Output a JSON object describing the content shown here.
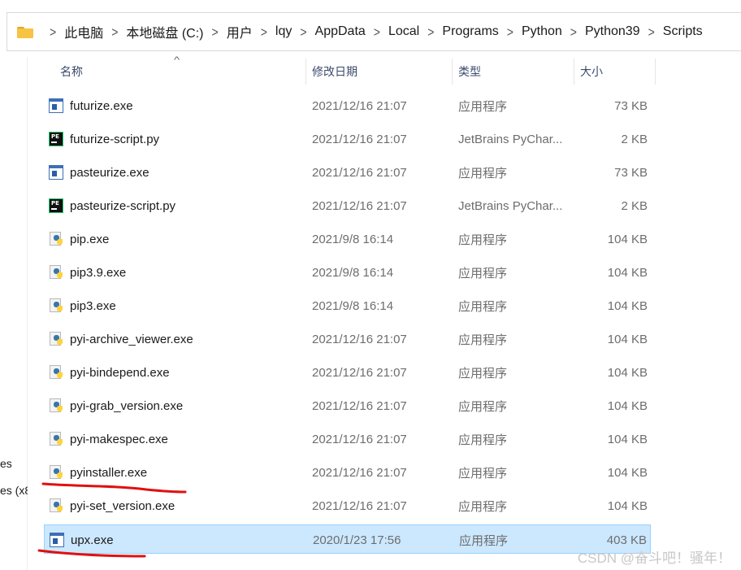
{
  "breadcrumb": [
    "此电脑",
    "本地磁盘 (C:)",
    "用户",
    "lqy",
    "AppData",
    "Local",
    "Programs",
    "Python",
    "Python39",
    "Scripts"
  ],
  "nav_fragments": [
    "es",
    "es (x8"
  ],
  "columns": {
    "name": "名称",
    "date": "修改日期",
    "type": "类型",
    "size": "大小"
  },
  "files": [
    {
      "name": "futurize.exe",
      "date": "2021/12/16 21:07",
      "type": "应用程序",
      "size": "73 KB",
      "icon": "exe-icon"
    },
    {
      "name": "futurize-script.py",
      "date": "2021/12/16 21:07",
      "type": "JetBrains PyChar...",
      "size": "2 KB",
      "icon": "pycharm-file-icon"
    },
    {
      "name": "pasteurize.exe",
      "date": "2021/12/16 21:07",
      "type": "应用程序",
      "size": "73 KB",
      "icon": "exe-icon"
    },
    {
      "name": "pasteurize-script.py",
      "date": "2021/12/16 21:07",
      "type": "JetBrains PyChar...",
      "size": "2 KB",
      "icon": "pycharm-file-icon"
    },
    {
      "name": "pip.exe",
      "date": "2021/9/8 16:14",
      "type": "应用程序",
      "size": "104 KB",
      "icon": "python-exe-icon"
    },
    {
      "name": "pip3.9.exe",
      "date": "2021/9/8 16:14",
      "type": "应用程序",
      "size": "104 KB",
      "icon": "python-exe-icon"
    },
    {
      "name": "pip3.exe",
      "date": "2021/9/8 16:14",
      "type": "应用程序",
      "size": "104 KB",
      "icon": "python-exe-icon"
    },
    {
      "name": "pyi-archive_viewer.exe",
      "date": "2021/12/16 21:07",
      "type": "应用程序",
      "size": "104 KB",
      "icon": "python-exe-icon"
    },
    {
      "name": "pyi-bindepend.exe",
      "date": "2021/12/16 21:07",
      "type": "应用程序",
      "size": "104 KB",
      "icon": "python-exe-icon"
    },
    {
      "name": "pyi-grab_version.exe",
      "date": "2021/12/16 21:07",
      "type": "应用程序",
      "size": "104 KB",
      "icon": "python-exe-icon"
    },
    {
      "name": "pyi-makespec.exe",
      "date": "2021/12/16 21:07",
      "type": "应用程序",
      "size": "104 KB",
      "icon": "python-exe-icon"
    },
    {
      "name": "pyinstaller.exe",
      "date": "2021/12/16 21:07",
      "type": "应用程序",
      "size": "104 KB",
      "icon": "python-exe-icon"
    },
    {
      "name": "pyi-set_version.exe",
      "date": "2021/12/16 21:07",
      "type": "应用程序",
      "size": "104 KB",
      "icon": "python-exe-icon"
    },
    {
      "name": "upx.exe",
      "date": "2020/1/23 17:56",
      "type": "应用程序",
      "size": "403 KB",
      "icon": "exe-icon"
    }
  ],
  "selected_file": "upx.exe",
  "underlined_files": [
    "pyinstaller.exe",
    "upx.exe"
  ],
  "colors": {
    "selection": "#cce8ff",
    "selection_border": "#99d1ff",
    "annotation": "#e01010",
    "folder": "#f6c344"
  },
  "watermark": "CSDN @奋斗吧！骚年！"
}
